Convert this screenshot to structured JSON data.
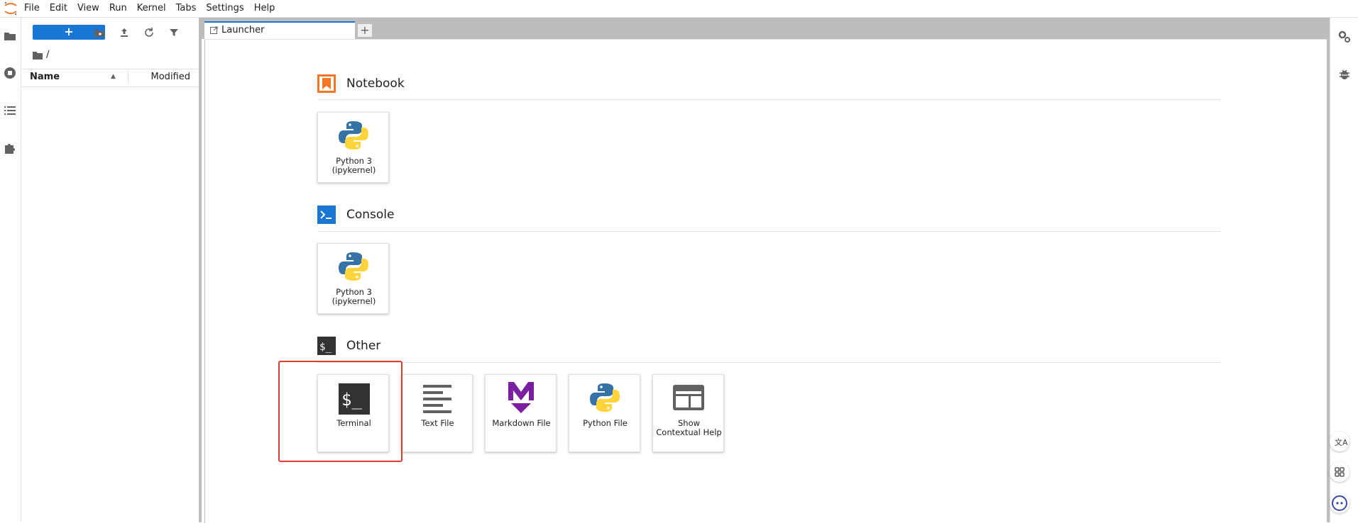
{
  "menubar": {
    "items": [
      "File",
      "Edit",
      "View",
      "Run",
      "Kernel",
      "Tabs",
      "Settings",
      "Help"
    ]
  },
  "filebrowser": {
    "new_label": "+",
    "breadcrumb": "/",
    "columns": {
      "name": "Name",
      "modified": "Modified"
    }
  },
  "tabs": {
    "active_label": "Launcher",
    "add_label": "+"
  },
  "launcher": {
    "sections": [
      {
        "title": "Notebook",
        "cards": [
          {
            "label": "Python 3 (ipykernel)"
          }
        ]
      },
      {
        "title": "Console",
        "cards": [
          {
            "label": "Python 3 (ipykernel)"
          }
        ]
      },
      {
        "title": "Other",
        "cards": [
          {
            "label": "Terminal"
          },
          {
            "label": "Text File"
          },
          {
            "label": "Markdown File"
          },
          {
            "label": "Python File"
          },
          {
            "label": "Show Contextual Help"
          }
        ]
      }
    ]
  },
  "icons": {
    "left": [
      "folder-icon",
      "running-icon",
      "toc-icon",
      "extension-icon"
    ],
    "right": [
      "property-inspector-icon",
      "debugger-icon"
    ]
  },
  "colors": {
    "accent": "#1976d2",
    "highlight": "#e53935",
    "notebook": "#f37726",
    "console": "#1976d2",
    "markdown": "#7b1fa2"
  }
}
